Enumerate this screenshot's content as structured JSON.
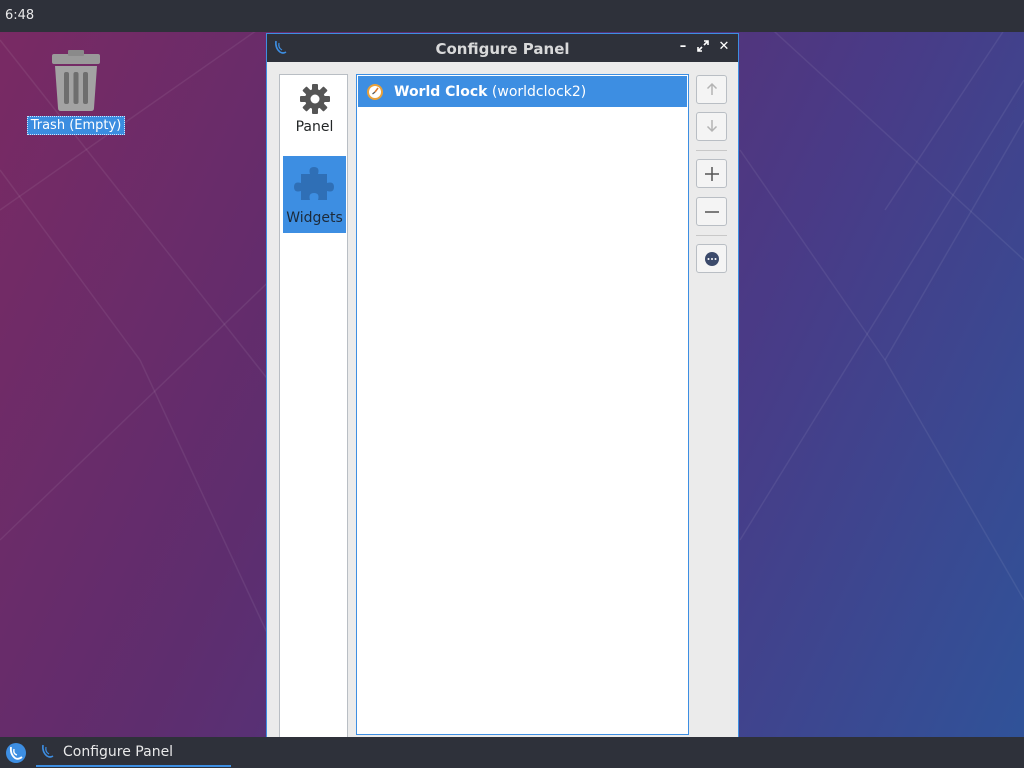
{
  "top_panel": {
    "clock": "6:48"
  },
  "desktop": {
    "icons": [
      {
        "label": "Trash (Empty)",
        "icon": "trash-icon"
      }
    ]
  },
  "window": {
    "title": "Configure Panel",
    "controls": {
      "minimize": "minimize-icon",
      "maximize": "maximize-icon",
      "close": "close-icon"
    },
    "nav": [
      {
        "label": "Panel",
        "icon": "gear-icon",
        "selected": false
      },
      {
        "label": "Widgets",
        "icon": "puzzle-icon",
        "selected": true
      }
    ],
    "widgets": [
      {
        "name": "World Clock",
        "id": "(worldclock2)",
        "icon": "clock-icon",
        "selected": true
      }
    ],
    "side_buttons": [
      {
        "icon": "arrow-up-icon",
        "enabled": false
      },
      {
        "icon": "arrow-down-icon",
        "enabled": false
      },
      {
        "icon": "plus-icon",
        "enabled": true
      },
      {
        "icon": "minus-icon",
        "enabled": true
      },
      {
        "icon": "more-icon",
        "enabled": true
      }
    ]
  },
  "taskbar": {
    "start_icon": "lxqt-logo-icon",
    "tasks": [
      {
        "label": "Configure Panel",
        "icon": "lxqt-logo-icon",
        "active": true
      }
    ]
  },
  "colors": {
    "accent": "#3d8ee2",
    "panel": "#2e313a",
    "window_bg": "#ebebeb"
  }
}
